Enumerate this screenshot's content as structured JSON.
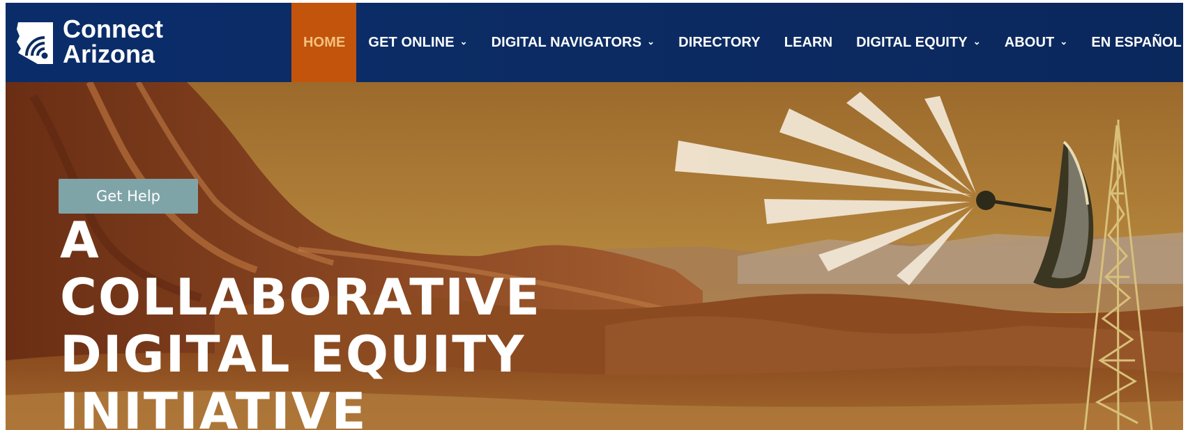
{
  "brand": {
    "line1": "Connect",
    "line2": "Arizona"
  },
  "nav": {
    "items": [
      {
        "label": "HOME",
        "active": true,
        "dropdown": false
      },
      {
        "label": "GET ONLINE",
        "active": false,
        "dropdown": true
      },
      {
        "label": "DIGITAL NAVIGATORS",
        "active": false,
        "dropdown": true
      },
      {
        "label": "DIRECTORY",
        "active": false,
        "dropdown": false
      },
      {
        "label": "LEARN",
        "active": false,
        "dropdown": false
      },
      {
        "label": "DIGITAL EQUITY",
        "active": false,
        "dropdown": true
      },
      {
        "label": "ABOUT",
        "active": false,
        "dropdown": true
      },
      {
        "label": "EN ESPAÑOL",
        "active": false,
        "dropdown": false
      }
    ],
    "chevron_icon": "chevron-down-icon"
  },
  "hero": {
    "cta_label": "Get Help",
    "headline": [
      "A COLLABORATIVE",
      "DIGITAL EQUITY",
      "INITIATIVE"
    ]
  },
  "colors": {
    "header_bg": "#0c2b63",
    "active_tab_bg": "#c2540c",
    "active_tab_text": "#f5c27e",
    "cta_bg": "#7fa4a8"
  }
}
